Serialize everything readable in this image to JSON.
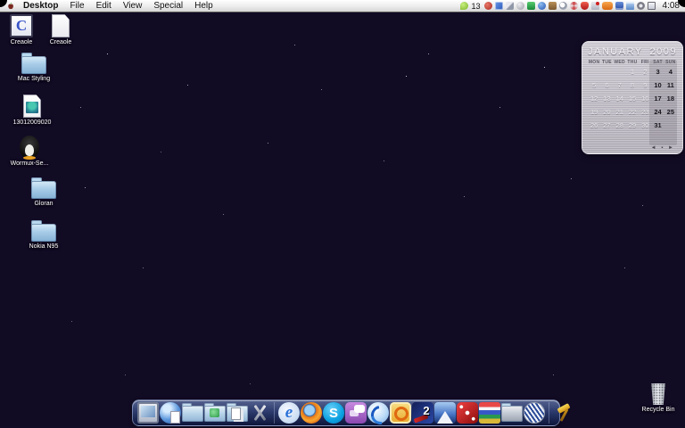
{
  "menu_bar": {
    "apple_icon": "apple-logo-icon",
    "menus": [
      {
        "label": "Desktop",
        "bold": true
      },
      {
        "label": "File"
      },
      {
        "label": "Edit"
      },
      {
        "label": "View"
      },
      {
        "label": "Special"
      },
      {
        "label": "Help"
      }
    ],
    "tray": {
      "icons": [
        {
          "name": "antivirus-leaf-icon",
          "kind": "leaf"
        },
        {
          "name": "tray-counter",
          "text": "13"
        },
        {
          "name": "red-status-icon",
          "kind": "redface"
        },
        {
          "name": "desktop-manager-icon",
          "kind": "bluegrid"
        },
        {
          "name": "wrench-icon",
          "kind": "wrench"
        },
        {
          "name": "gray-sphere-icon",
          "kind": "sphere"
        },
        {
          "name": "green-app-icon",
          "kind": "greensq"
        },
        {
          "name": "blue-globe-icon",
          "kind": "blueglobe"
        },
        {
          "name": "briefcase-icon",
          "kind": "briefcase"
        },
        {
          "name": "search-icon",
          "kind": "magnifier"
        },
        {
          "name": "swirl-icon",
          "kind": "swirl"
        },
        {
          "name": "security-shield-icon",
          "kind": "redshield"
        },
        {
          "name": "volume-muted-icon",
          "kind": "mute"
        },
        {
          "name": "modem-icon",
          "kind": "modem"
        },
        {
          "name": "users-icon",
          "kind": "users"
        },
        {
          "name": "window-icon",
          "kind": "window"
        },
        {
          "name": "clock-icon",
          "kind": "clockface"
        },
        {
          "name": "display-icon",
          "kind": "monitor"
        }
      ],
      "time": "4:08"
    }
  },
  "desktop": {
    "icons": [
      {
        "label": "Creaole",
        "kind": "appc",
        "glyph": "C"
      },
      {
        "label": "Creaole",
        "kind": "document"
      },
      {
        "label": "Mac Styling",
        "kind": "folder"
      },
      {
        "label": "13012009020",
        "kind": "image"
      },
      {
        "label": "Wormux-Se...",
        "kind": "penguin"
      },
      {
        "label": "Gloran",
        "kind": "folder"
      },
      {
        "label": "Nokia N95",
        "kind": "folder"
      },
      {
        "label": "Recycle Bin",
        "kind": "trash"
      }
    ]
  },
  "calendar": {
    "month": "JANUARY",
    "year": "2009",
    "day_headers": [
      "MON",
      "TUE",
      "WED",
      "THU",
      "FRI",
      "SAT",
      "SUN"
    ],
    "weeks": [
      [
        "",
        "",
        "",
        "1",
        "2",
        "3",
        "4"
      ],
      [
        "5",
        "6",
        "7",
        "8",
        "9",
        "10",
        "11"
      ],
      [
        "12",
        "13",
        "14",
        "15",
        "16",
        "17",
        "18"
      ],
      [
        "19",
        "20",
        "21",
        "22",
        "23",
        "24",
        "25"
      ],
      [
        "26",
        "27",
        "28",
        "29",
        "30",
        "31",
        ""
      ]
    ],
    "nav": "◄ ▪ ►"
  },
  "dock": {
    "sections": [
      {
        "items": [
          {
            "name": "dock-my-computer",
            "kind": "monitor"
          },
          {
            "name": "dock-network-globe",
            "kind": "globedoc"
          },
          {
            "name": "dock-documents-folder",
            "kind": "folder"
          },
          {
            "name": "dock-programs-folder",
            "kind": "foldergreen"
          },
          {
            "name": "dock-files-folder",
            "kind": "folderdocs"
          },
          {
            "name": "dock-utilities-tools",
            "kind": "tools"
          }
        ]
      },
      {
        "items": [
          {
            "name": "dock-internet-explorer",
            "kind": "ie",
            "glyph": "e"
          },
          {
            "name": "dock-firefox",
            "kind": "firefox"
          },
          {
            "name": "dock-skype",
            "kind": "skype",
            "glyph": "S"
          },
          {
            "name": "dock-chat-app",
            "kind": "chat"
          },
          {
            "name": "dock-messenger",
            "kind": "messenger"
          },
          {
            "name": "dock-media-app",
            "kind": "clockapp"
          },
          {
            "name": "dock-game-2",
            "kind": "game2",
            "glyph": "2"
          },
          {
            "name": "dock-ski-game",
            "kind": "ski"
          },
          {
            "name": "dock-dice-game",
            "kind": "dice"
          },
          {
            "name": "dock-poker-chips",
            "kind": "chips"
          },
          {
            "name": "dock-open-folder",
            "kind": "folderopen"
          },
          {
            "name": "dock-crest-logo",
            "kind": "crest"
          }
        ]
      },
      {
        "items": [
          {
            "name": "dock-gold-hammer",
            "kind": "hammer"
          }
        ]
      }
    ]
  },
  "colors": {
    "menu_bar_bg": "#ececec",
    "dock_bg": "#24386e",
    "calendar_metal": "#bab6c0",
    "wallpaper_purple": "#3b2a72",
    "wallpaper_blue": "#1a2a6e",
    "burst_white": "#ffffff"
  }
}
